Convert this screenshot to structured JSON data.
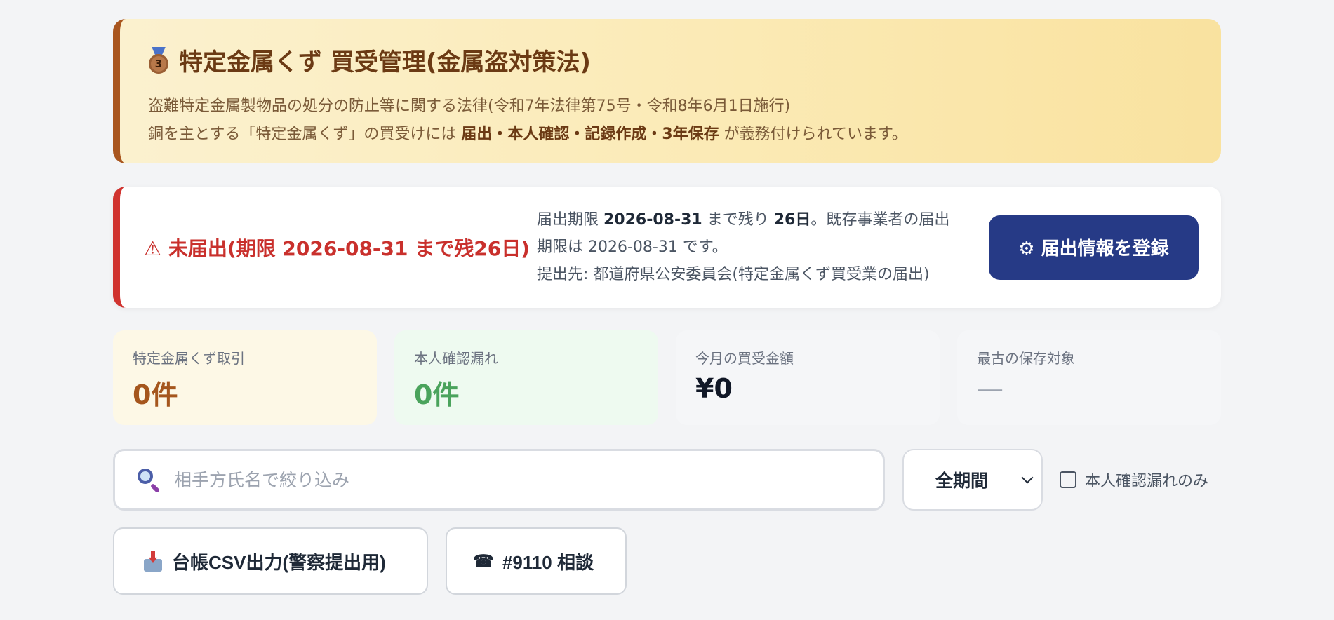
{
  "hero": {
    "medal_number": "3",
    "title": "特定金属くず 買受管理(金属盗対策法)",
    "line1": "盗難特定金属製物品の処分の防止等に関する法律(令和7年法律第75号・令和8年6月1日施行)",
    "line2_prefix": "銅を主とする「特定金属くず」の買受けには ",
    "line2_bold": "届出・本人確認・記録作成・3年保存",
    "line2_suffix": " が義務付けられています。"
  },
  "alert": {
    "icon": "⚠",
    "title": "未届出(期限 2026-08-31 まで残26日)",
    "t1": "届出期限 ",
    "deadline_bold": "2026-08-31",
    "t2": " まで残り ",
    "days_bold": "26日",
    "t3": "。既存事業者の届出期限は 2026-08-31 です。",
    "t4": "提出先: 都道府県公安委員会(特定金属くず買受業の届出)",
    "register_icon": "⚙",
    "register_label": "届出情報を登録"
  },
  "stats": [
    {
      "label": "特定金属くず取引",
      "value": "0件"
    },
    {
      "label": "本人確認漏れ",
      "value": "0件"
    },
    {
      "label": "今月の買受金額",
      "value": "¥0"
    },
    {
      "label": "最古の保存対象",
      "value": "—"
    }
  ],
  "filters": {
    "search_placeholder": "相手方氏名で絞り込み",
    "search_value": "",
    "period_selected": "全期間",
    "checkbox_label": "本人確認漏れのみ",
    "checkbox_checked": false
  },
  "actions": {
    "csv_label": "台帳CSV出力(警察提出用)",
    "consult_icon": "☎",
    "consult_label": "#9110 相談"
  },
  "colors": {
    "accent_brown": "#a9561f",
    "alert_red": "#d0332f",
    "primary_navy": "#263a86",
    "success_green": "#4aa35c"
  }
}
